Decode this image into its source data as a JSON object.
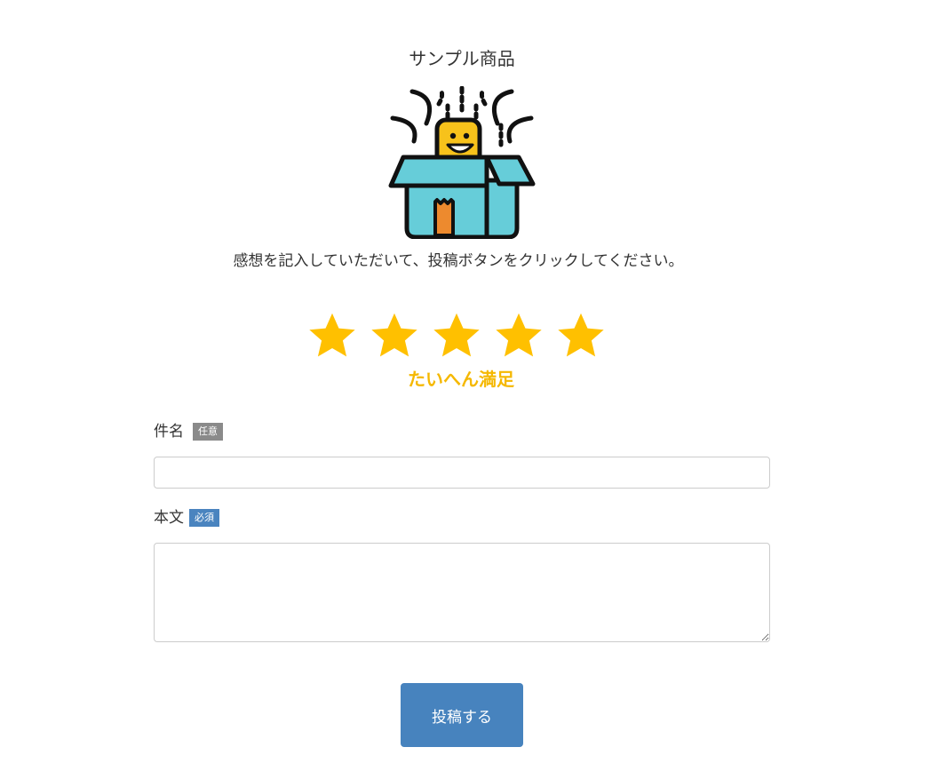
{
  "product": {
    "title": "サンプル商品",
    "image_icon": "surprise-box-icon"
  },
  "instruction": "感想を記入していただいて、投稿ボタンをクリックしてください。",
  "rating": {
    "max": 5,
    "value": 5,
    "label": "たいへん満足",
    "color": "#f5b800"
  },
  "form": {
    "subject": {
      "label": "件名",
      "badge": "任意",
      "value": "",
      "placeholder": ""
    },
    "body": {
      "label": "本文",
      "badge": "必須",
      "value": "",
      "placeholder": ""
    },
    "submit_label": "投稿する"
  },
  "colors": {
    "star": "#ffc000",
    "rating_text": "#f5b800",
    "badge_optional": "#8a8a8a",
    "badge_required": "#4a84bf",
    "submit_button": "#4783be"
  }
}
